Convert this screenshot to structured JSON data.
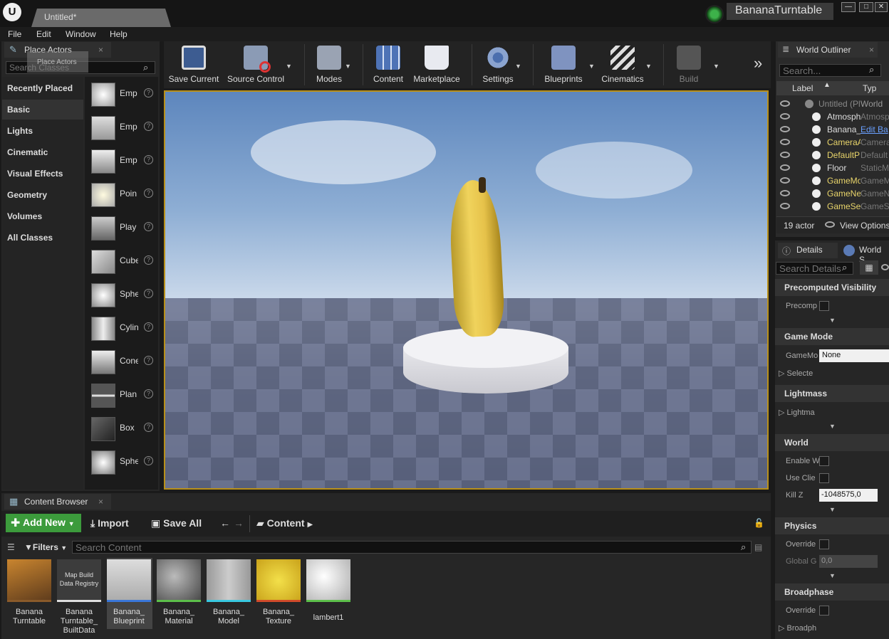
{
  "window": {
    "tab_title": "Untitled*",
    "project_name": "BananaTurntable",
    "controls": [
      "—",
      "□",
      "✕"
    ]
  },
  "menu": [
    "File",
    "Edit",
    "Window",
    "Help"
  ],
  "place_actors": {
    "tab_label": "Place Actors",
    "drag_ghost": "Place Actors",
    "search_placeholder": "Search Classes",
    "categories": [
      "Recently Placed",
      "Basic",
      "Lights",
      "Cinematic",
      "Visual Effects",
      "Geometry",
      "Volumes",
      "All Classes"
    ],
    "selected_category": "Basic",
    "items": [
      "Emp",
      "Emp",
      "Emp",
      "Poin",
      "Play",
      "Cube",
      "Sphe",
      "Cylin",
      "Cone",
      "Plan",
      "Box",
      "Sphe"
    ],
    "help_glyph": "?"
  },
  "toolbar": {
    "buttons": [
      {
        "label": "Save Current",
        "icon": "save-icon"
      },
      {
        "label": "Source Control",
        "icon": "source-control-icon"
      },
      {
        "label": "Modes",
        "icon": "modes-icon"
      },
      {
        "label": "Content",
        "icon": "content-icon"
      },
      {
        "label": "Marketplace",
        "icon": "marketplace-icon"
      },
      {
        "label": "Settings",
        "icon": "settings-icon"
      },
      {
        "label": "Blueprints",
        "icon": "blueprints-icon"
      },
      {
        "label": "Cinematics",
        "icon": "cinematics-icon"
      },
      {
        "label": "Build",
        "icon": "build-icon"
      }
    ],
    "overflow": "»",
    "dropdown_glyph": "▼"
  },
  "world_outliner": {
    "tab_label": "World Outliner",
    "search_placeholder": "Search...",
    "col_label": "Label",
    "col_type": "Typ",
    "rows": [
      {
        "label": "Untitled (Pl",
        "type": "World",
        "muted": true
      },
      {
        "label": "Atmosph",
        "type": "Atmosp"
      },
      {
        "label": "Banana_",
        "type": "Edit Ba",
        "link": true
      },
      {
        "label": "CameraA",
        "type": "Camera"
      },
      {
        "label": "DefaultP",
        "type": "Default"
      },
      {
        "label": "Floor",
        "type": "StaticM"
      },
      {
        "label": "GameMo",
        "type": "GameM"
      },
      {
        "label": "GameNe",
        "type": "GameN"
      },
      {
        "label": "GameSes",
        "type": "GameS"
      }
    ],
    "actor_count": "19 actor",
    "view_options": "View Options"
  },
  "details": {
    "tab_details": "Details",
    "tab_world": "World S",
    "search_placeholder": "Search Details",
    "sections": {
      "precomputed": "Precomputed Visibility",
      "game_mode": "Game Mode",
      "lightmass": "Lightmass",
      "world": "World",
      "physics": "Physics",
      "broadphase": "Broadphase"
    },
    "props": {
      "precomp": "Precomp",
      "gamemode": "GameMo",
      "gamemode_value": "None",
      "selected": "Selecte",
      "lightmass": "Lightma",
      "enable_w": "Enable W",
      "use_client": "Use Clie",
      "kill_z": "Kill Z",
      "kill_z_value": "-1048575,0",
      "override": "Override",
      "global_g": "Global G",
      "global_g_value": "0,0",
      "override2": "Override",
      "broadphase": "Broadph"
    }
  },
  "content_browser": {
    "tab_label": "Content Browser",
    "add_new": "Add New",
    "import": "Import",
    "save_all": "Save All",
    "path": "Content",
    "filters": "Filters",
    "search_placeholder": "Search Content",
    "assets": [
      {
        "name": "Banana\nTurntable",
        "bar": "#8a5a2a"
      },
      {
        "name": "Banana\nTurntable_\nBuiltData",
        "bar": "#dddddd",
        "thumb_text": "Map Build\nData Registry"
      },
      {
        "name": "Banana_\nBlueprint",
        "bar": "#3a77d9"
      },
      {
        "name": "Banana_\nMaterial",
        "bar": "#5cbf4a"
      },
      {
        "name": "Banana_\nModel",
        "bar": "#39c8e0"
      },
      {
        "name": "Banana_\nTexture",
        "bar": "#d04a2a"
      },
      {
        "name": "lambert1",
        "bar": "#5cbf4a"
      }
    ]
  },
  "colors": {
    "accent_green": "#3c9b3c",
    "viewport_border": "#b8901a"
  }
}
